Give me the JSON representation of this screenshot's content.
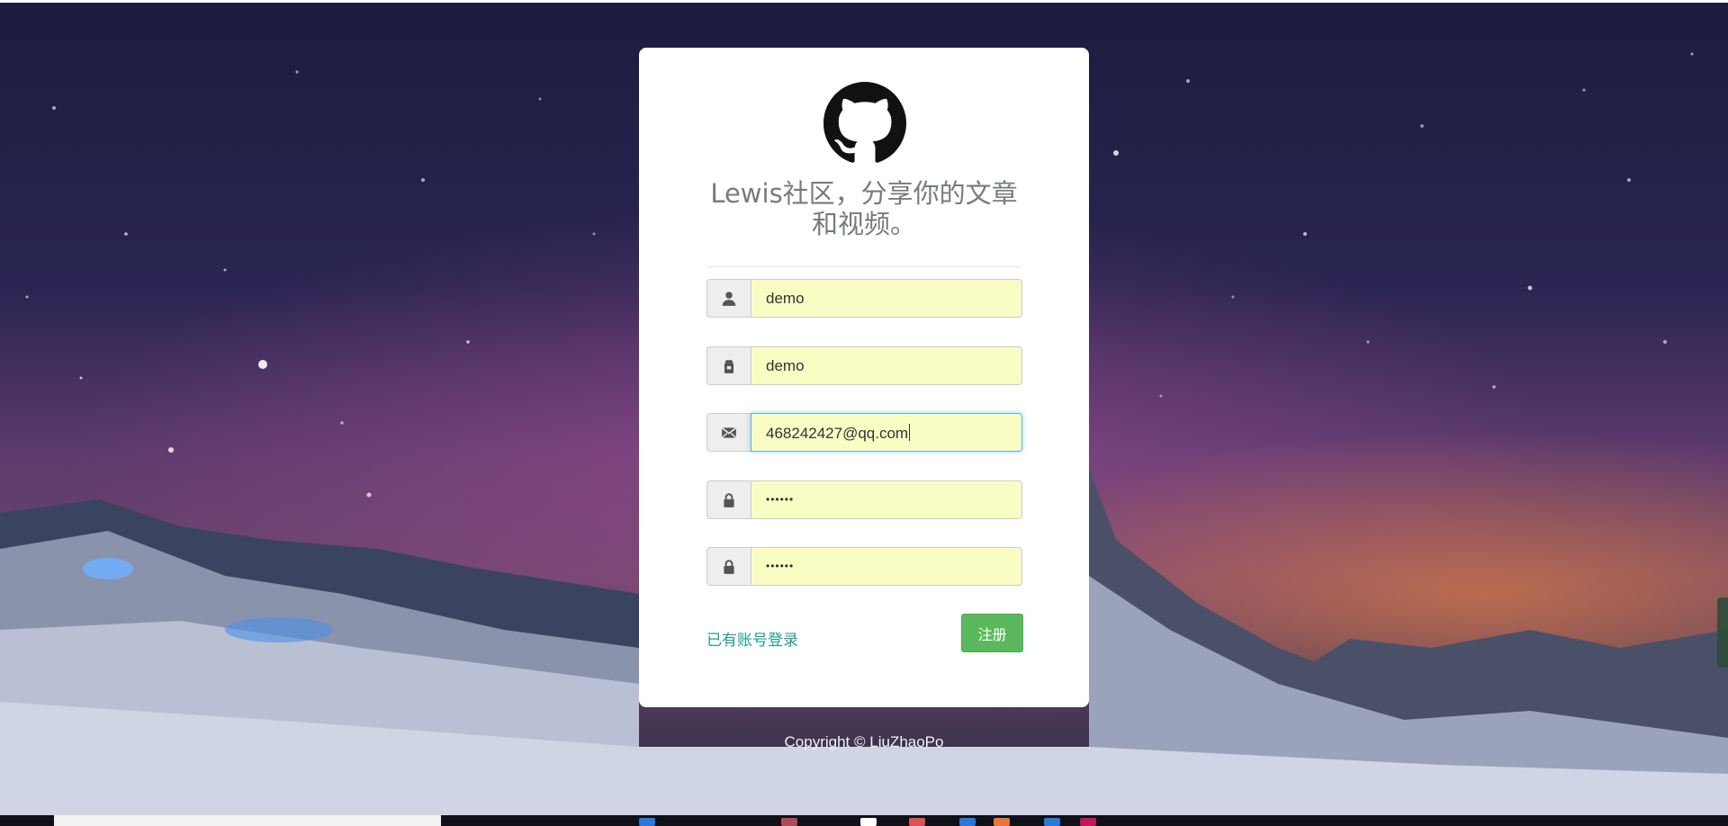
{
  "app": {
    "title": "Lewis社区，分享你的文章和视频。",
    "title_line1": "Lewis社区，分享你的文章",
    "title_line2": "和视频。"
  },
  "form": {
    "username": {
      "value": "demo",
      "icon": "user-icon"
    },
    "nickname": {
      "value": "demo",
      "icon": "id-icon"
    },
    "email": {
      "value": "468242427@qq.com",
      "icon": "envelope-icon"
    },
    "password": {
      "value": "••••••",
      "icon": "lock-icon"
    },
    "confirm_password": {
      "value": "••••••",
      "icon": "lock-icon"
    }
  },
  "actions": {
    "login_link": "已有账号登录",
    "register_button": "注册"
  },
  "footer": {
    "copyright": "Copyright © LiuZhaoPo"
  },
  "colors": {
    "accent_green": "#5cb85c",
    "link_teal": "#1e9e8a",
    "autofill_yellow": "#fafdc3"
  }
}
